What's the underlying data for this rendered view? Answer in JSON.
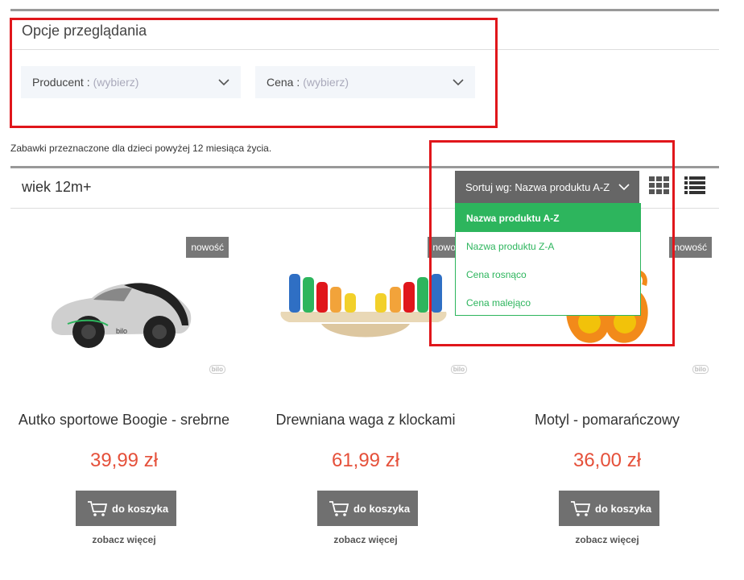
{
  "filters": {
    "title": "Opcje przeglądania",
    "producer": {
      "label": "Producent :",
      "placeholder": "(wybierz)"
    },
    "price": {
      "label": "Cena :",
      "placeholder": "(wybierz)"
    }
  },
  "description": "Zabawki przeznaczone dla dzieci powyżej 12 miesiąca życia.",
  "category_title": "wiek 12m+",
  "sort": {
    "label": "Sortuj wg: Nazwa produktu A-Z",
    "options": [
      "Nazwa produktu A-Z",
      "Nazwa produktu Z-A",
      "Cena rosnąco",
      "Cena malejąco"
    ],
    "selected_index": 0
  },
  "colors": {
    "accent": "#2db55d",
    "price": "#e5503a",
    "highlight": "#e0161b",
    "button": "#707070"
  },
  "products": [
    {
      "badge": "nowość",
      "name": "Autko sportowe Boogie - srebrne",
      "price": "39,99 zł",
      "brand": "bilo",
      "cart_label": "do koszyka",
      "more_label": "zobacz więcej"
    },
    {
      "badge": "nowość",
      "name": "Drewniana waga z klockami",
      "price": "61,99 zł",
      "brand": "bilo",
      "cart_label": "do koszyka",
      "more_label": "zobacz więcej"
    },
    {
      "badge": "nowość",
      "name": "Motyl - pomarańczowy",
      "price": "36,00 zł",
      "brand": "bilo",
      "cart_label": "do koszyka",
      "more_label": "zobacz więcej"
    }
  ]
}
